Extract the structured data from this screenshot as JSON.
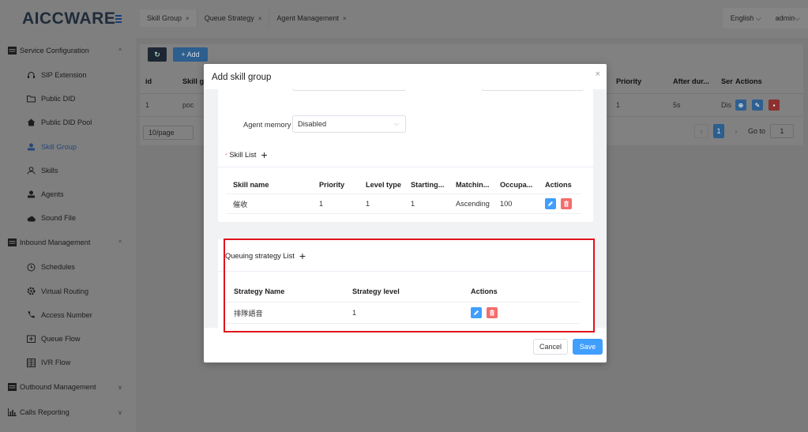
{
  "app": {
    "logo": "AICCWARE"
  },
  "sidebar": {
    "groups": [
      {
        "label": "Service Configuration",
        "icon": "config-icon",
        "items": [
          {
            "label": "SIP Extension",
            "icon": "headset-icon"
          },
          {
            "label": "Public DID",
            "icon": "folder-icon"
          },
          {
            "label": "Public DID Pool",
            "icon": "home-icon"
          },
          {
            "label": "Skill Group",
            "icon": "user-icon",
            "active": true
          },
          {
            "label": "Skills",
            "icon": "user-outline-icon"
          },
          {
            "label": "Agents",
            "icon": "agent-icon"
          },
          {
            "label": "Sound File",
            "icon": "cloud-icon"
          }
        ]
      },
      {
        "label": "Inbound Management",
        "icon": "list-icon",
        "items": [
          {
            "label": "Schedules",
            "icon": "clock-icon"
          },
          {
            "label": "Virtual Routing",
            "icon": "gear-icon"
          },
          {
            "label": "Access Number",
            "icon": "phone-icon"
          },
          {
            "label": "Queue Flow",
            "icon": "queue-icon"
          },
          {
            "label": "IVR Flow",
            "icon": "grid-icon"
          }
        ]
      },
      {
        "label": "Outbound Management",
        "icon": "list-icon",
        "items": []
      },
      {
        "label": "Calls Reporting",
        "icon": "bar-chart-icon",
        "items": []
      }
    ]
  },
  "tabs": [
    {
      "label": "Skill Group"
    },
    {
      "label": "Queue Strategy"
    },
    {
      "label": "Agent Management"
    }
  ],
  "header": {
    "language": "English",
    "user": "admin"
  },
  "toolbar": {
    "add_label": "+ Add"
  },
  "bg_table": {
    "headers": [
      "id",
      "Skill gr",
      "Priority",
      "After dur...",
      "Ser",
      "Actions"
    ],
    "row": [
      "1",
      "poc",
      "1",
      "5s",
      "Dis"
    ]
  },
  "pagination": {
    "page_size": "10/page",
    "current": "1",
    "goto_label": "Go to",
    "goto_value": "1"
  },
  "modal": {
    "title": "Add skill group",
    "agent_memory_label": "Agent memory",
    "agent_memory_value": "Disabled",
    "skill_list": {
      "title": "Skill List",
      "headers": [
        "Skill name",
        "Priority",
        "Level type",
        "Starting...",
        "Matchin...",
        "Occupa...",
        "Actions"
      ],
      "rows": [
        [
          "催收",
          "1",
          "1",
          "1",
          "Ascending",
          "100"
        ]
      ]
    },
    "queuing_list": {
      "title": "Queuing strategy List",
      "headers": [
        "Strategy Name",
        "Strategy level",
        "Actions"
      ],
      "rows": [
        [
          "排隊語音",
          "1"
        ]
      ]
    },
    "cancel_label": "Cancel",
    "save_label": "Save"
  },
  "colors": {
    "primary": "#409eff",
    "danger": "#f56c6c",
    "highlight": "#e0121c"
  }
}
